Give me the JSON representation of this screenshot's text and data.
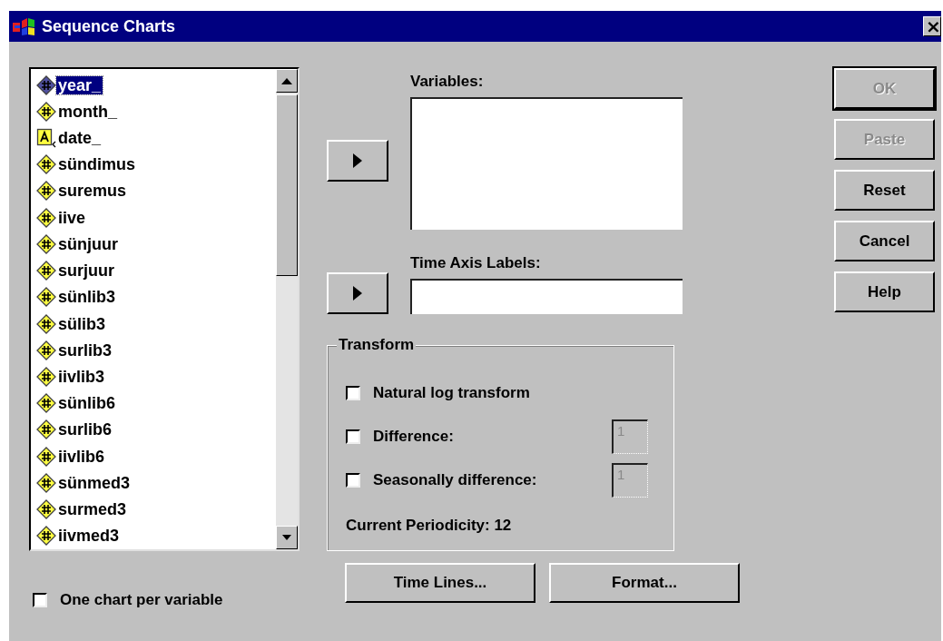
{
  "window": {
    "title": "Sequence Charts",
    "close": "×"
  },
  "variable_list": {
    "items": [
      {
        "name": "year_",
        "kind": "numeric",
        "selected": true
      },
      {
        "name": "month_",
        "kind": "numeric",
        "selected": false
      },
      {
        "name": "date_",
        "kind": "string",
        "selected": false
      },
      {
        "name": "sündimus",
        "kind": "numeric",
        "selected": false
      },
      {
        "name": "suremus",
        "kind": "numeric",
        "selected": false
      },
      {
        "name": "iive",
        "kind": "numeric",
        "selected": false
      },
      {
        "name": "sünjuur",
        "kind": "numeric",
        "selected": false
      },
      {
        "name": "surjuur",
        "kind": "numeric",
        "selected": false
      },
      {
        "name": "sünlib3",
        "kind": "numeric",
        "selected": false
      },
      {
        "name": "sülib3",
        "kind": "numeric",
        "selected": false
      },
      {
        "name": "surlib3",
        "kind": "numeric",
        "selected": false
      },
      {
        "name": "iivlib3",
        "kind": "numeric",
        "selected": false
      },
      {
        "name": "sünlib6",
        "kind": "numeric",
        "selected": false
      },
      {
        "name": "surlib6",
        "kind": "numeric",
        "selected": false
      },
      {
        "name": "iivlib6",
        "kind": "numeric",
        "selected": false
      },
      {
        "name": "sünmed3",
        "kind": "numeric",
        "selected": false
      },
      {
        "name": "surmed3",
        "kind": "numeric",
        "selected": false
      },
      {
        "name": "iivmed3",
        "kind": "numeric",
        "selected": false
      }
    ]
  },
  "one_chart_per_variable": {
    "label": "One chart per variable",
    "checked": false
  },
  "variables": {
    "label": "Variables:"
  },
  "time_axis_labels": {
    "label": "Time Axis Labels:"
  },
  "transform": {
    "title": "Transform",
    "options": [
      {
        "label": "Natural log transform",
        "checked": false
      },
      {
        "label": "Difference:",
        "checked": false,
        "value": "1",
        "disabled": true
      },
      {
        "label": "Seasonally difference:",
        "checked": false,
        "value": "1",
        "disabled": true
      }
    ],
    "periodicity": "Current Periodicity:  12"
  },
  "bottom_buttons": [
    {
      "label": "Time Lines..."
    },
    {
      "label": "Format..."
    }
  ],
  "side_buttons": [
    {
      "label": "OK",
      "disabled": true,
      "default": true
    },
    {
      "label": "Paste",
      "disabled": true,
      "default": false
    },
    {
      "label": "Reset",
      "disabled": false,
      "default": false
    },
    {
      "label": "Cancel",
      "disabled": false,
      "default": false
    },
    {
      "label": "Help",
      "disabled": false,
      "default": false
    }
  ]
}
